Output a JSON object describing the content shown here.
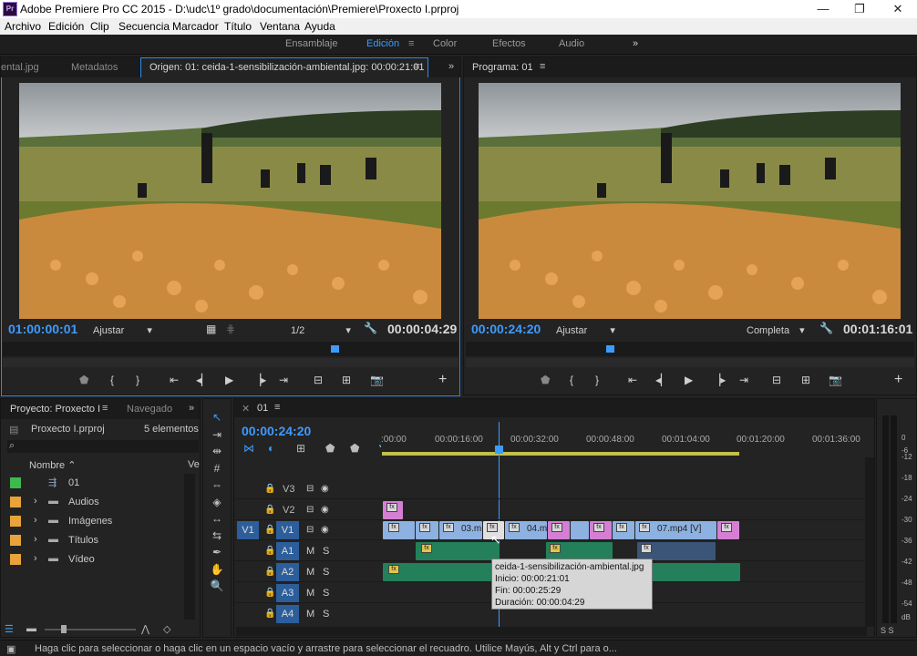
{
  "app": {
    "title": "Adobe Premiere Pro CC 2015 - D:\\udc\\1º grado\\documentación\\Premiere\\Proxecto I.prproj",
    "logo_text": "Pr"
  },
  "window": {
    "minimize": "—",
    "maximize": "❐",
    "close": "✕"
  },
  "menu": [
    "Archivo",
    "Edición",
    "Clip",
    "Secuencia",
    "Marcador",
    "Título",
    "Ventana",
    "Ayuda"
  ],
  "workspaces": {
    "items": [
      "Ensamblaje",
      "Edición",
      "Color",
      "Efectos",
      "Audio"
    ],
    "active": "Edición",
    "more": "»"
  },
  "source": {
    "tabs": [
      "ental.jpg",
      "Metadatos",
      "Origen: 01: ceida-1-sensibilización-ambiental.jpg: 00:00:21:01"
    ],
    "timecode_in": "01:00:00:01",
    "fit": "Ajustar",
    "resolution": "1/2",
    "timecode_dur": "00:00:04:29"
  },
  "program": {
    "tab": "Programa: 01",
    "timecode_in": "00:00:24:20",
    "fit": "Ajustar",
    "resolution": "Completa",
    "timecode_dur": "00:01:16:01"
  },
  "project": {
    "tabs": [
      "Proyecto: Proxecto I",
      "Navegado"
    ],
    "file": "Proxecto I.prproj",
    "count": "5 elementos",
    "col_name": "Nombre",
    "col_v": "Ve",
    "items": [
      {
        "name": "01",
        "color": "#3dba4e",
        "type": "sequence"
      },
      {
        "name": "Audios",
        "color": "#e8a33a",
        "type": "folder"
      },
      {
        "name": "Imágenes",
        "color": "#e8a33a",
        "type": "folder"
      },
      {
        "name": "Títulos",
        "color": "#e8a33a",
        "type": "folder"
      },
      {
        "name": "Vídeo",
        "color": "#e8a33a",
        "type": "folder"
      }
    ]
  },
  "timeline": {
    "tab": "01",
    "timecode": "00:00:24:20",
    "ruler": [
      ":00:00",
      "00:00:16:00",
      "00:00:32:00",
      "00:00:48:00",
      "00:01:04:00",
      "00:01:20:00",
      "00:01:36:00"
    ],
    "tracks": [
      "V3",
      "V2",
      "V1",
      "A1",
      "A2",
      "A3",
      "A4"
    ],
    "clip_labels": {
      "c3": "03.m",
      "c5": "04.m",
      "c7": "07.mp4 [V]"
    },
    "fx_label": "fx",
    "tooltip": {
      "name": "ceida-1-sensibilización-ambiental.jpg",
      "in": "Inicio: 00:00:21:01",
      "out": "Fin: 00:00:25:29",
      "dur": "Duración: 00:00:04:29"
    }
  },
  "meter": {
    "scale": [
      "0",
      "-6",
      "-12",
      "-18",
      "-24",
      "-30",
      "-36",
      "-42",
      "-48",
      "-54",
      "dB"
    ],
    "footer": "S  S"
  },
  "status": "Haga clic para seleccionar o haga clic en un espacio vacío y arrastre para seleccionar el recuadro. Utilice Mayús, Alt y Ctrl para o..."
}
